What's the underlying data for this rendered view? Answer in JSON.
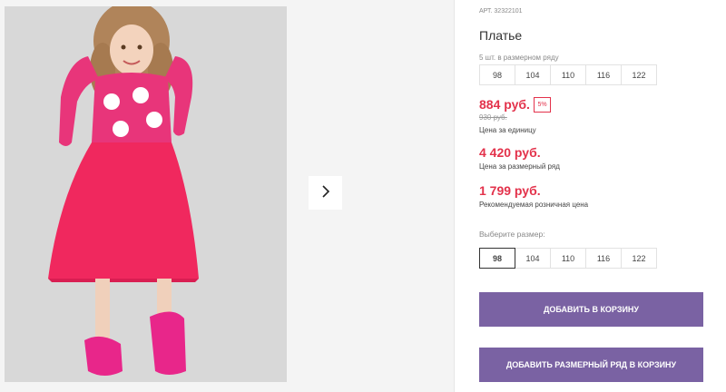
{
  "product": {
    "article": "АРТ. 32322101",
    "title": "Платье",
    "series_caption": "5 шт. в размерном ряду",
    "series_sizes": [
      "98",
      "104",
      "110",
      "116",
      "122"
    ]
  },
  "prices": {
    "unit_price": "884 руб.",
    "discount": "5%",
    "old_price": "930 руб.",
    "unit_caption": "Цена за единицу",
    "series_price": "4 420 руб.",
    "series_caption": "Цена за размерный ряд",
    "retail_price": "1 799 руб.",
    "retail_caption": "Рекомендуемая розничная цена"
  },
  "size_select": {
    "label": "Выберите размер:",
    "options": [
      "98",
      "104",
      "110",
      "116",
      "122"
    ],
    "selected": "98"
  },
  "buttons": {
    "add_to_cart": "ДОБАВИТЬ В КОРЗИНУ",
    "add_series_to_cart": "ДОБАВИТЬ РАЗМЕРНЫЙ РЯД В КОРЗИНУ"
  },
  "colors": {
    "price_red": "#e3324b",
    "button_purple": "#7a62a3",
    "dress_pink": "#f0285e"
  },
  "icons": {
    "gallery_next": "chevron-right-icon"
  }
}
